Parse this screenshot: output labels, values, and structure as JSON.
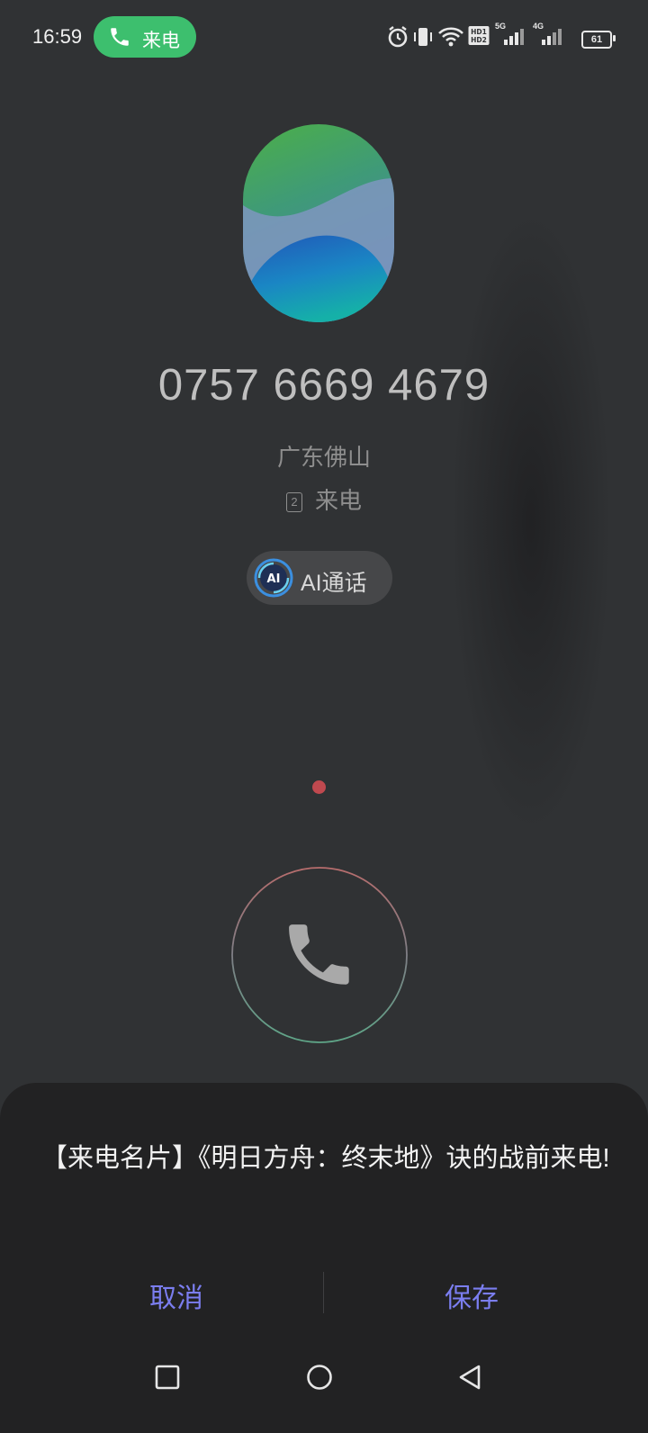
{
  "status_bar": {
    "time": "16:59",
    "call_indicator": "来电",
    "icons": [
      "alarm-icon",
      "vibrate-icon",
      "wifi-icon",
      "hd-icon",
      "signal-5g-icon",
      "signal-4g-icon"
    ],
    "hd_label": "HD1 HD2",
    "net_5g": "5G",
    "net_4g": "4G",
    "battery": "61"
  },
  "caller": {
    "number": "0757 6669 4679",
    "location": "广东佛山",
    "sim_slot": "2",
    "status": "来电"
  },
  "ai_call": {
    "logo": "AI",
    "label": "AI通话"
  },
  "sheet": {
    "message": "【来电名片】《明日方舟：终末地》诀的战前来电!",
    "cancel_label": "取消",
    "save_label": "保存"
  },
  "navbar": {
    "items": [
      "recents-square-icon",
      "home-circle-icon",
      "back-triangle-icon"
    ]
  },
  "colors": {
    "background": "#303234",
    "pill_green": "#3dbf6e",
    "accent": "#7b7ef0",
    "dot_red": "#c0494f"
  }
}
